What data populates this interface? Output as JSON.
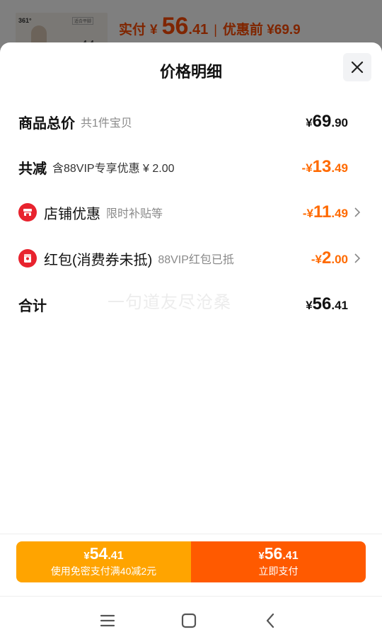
{
  "background": {
    "brand": "361°",
    "thumb_tag": "适合平脚",
    "thumb_num": "44",
    "price_label": "实付",
    "currency": "¥",
    "price_int": "56",
    "price_dec": ".41",
    "separator": "|",
    "orig_price": "优惠前 ¥69.9"
  },
  "sheet": {
    "title": "价格明细",
    "close_icon": "close-icon"
  },
  "rows": [
    {
      "label": "商品总价",
      "sub": "共1件宝贝",
      "currency": "¥",
      "int": "69",
      "dec": ".90",
      "color": "#111111"
    },
    {
      "label": "共减",
      "sub": "含88VIP专享优惠 ¥ 2.00",
      "currency": "-¥",
      "int": "13",
      "dec": ".49",
      "color": "#ff6a00"
    },
    {
      "icon": "shop-icon",
      "label": "店铺优惠",
      "sub": "限时补贴等",
      "currency": "-¥",
      "int": "11",
      "dec": ".49",
      "color": "#ff6a00",
      "chevron": "chevron-right-icon"
    },
    {
      "icon": "red-packet-icon",
      "label": "红包(消费券未抵)",
      "sub": "88VIP红包已抵",
      "currency": "-¥",
      "int": "2",
      "dec": ".00",
      "color": "#ff6a00",
      "chevron": "chevron-right-icon"
    },
    {
      "label": "合计",
      "currency": "¥",
      "int": "56",
      "dec": ".41",
      "color": "#111111"
    }
  ],
  "watermark": "一句道友尽沧桑",
  "pay": {
    "left": {
      "currency": "¥",
      "int": "54",
      "dec": ".41",
      "label": "使用免密支付满40减2元",
      "color": "#ffa400"
    },
    "right": {
      "currency": "¥",
      "int": "56",
      "dec": ".41",
      "label": "立即支付",
      "color": "#ff5a00"
    }
  },
  "system_nav": [
    "menu-icon",
    "home-icon",
    "back-icon"
  ]
}
